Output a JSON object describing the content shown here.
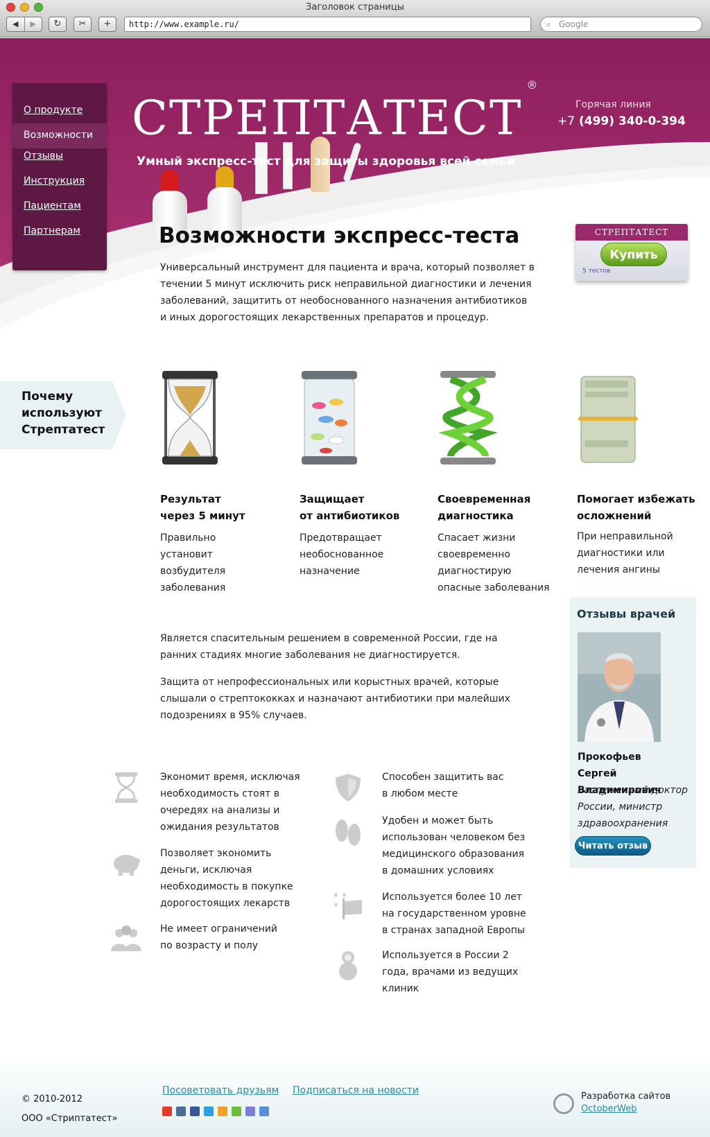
{
  "browser": {
    "title": "Заголовок страницы",
    "url": "http://www.example.ru/",
    "search_placeholder": "Google",
    "back_label": "◀",
    "forward_label": "▶",
    "reload_label": "↻",
    "snip_label": "✂",
    "newtab_label": "+"
  },
  "nav": {
    "items": [
      {
        "label": "О продукте"
      },
      {
        "label": "Возможности"
      },
      {
        "label": "Отзывы"
      },
      {
        "label": "Инструкция"
      },
      {
        "label": "Пациентам"
      },
      {
        "label": "Партнерам"
      }
    ],
    "active_index": 1
  },
  "header": {
    "brand": "СТРЕПТАТЕСТ",
    "brand_mark": "®",
    "tagline": "Умный экспресс-тест для защиты здоровья всей семьи",
    "hotline_label": "Горячая линия",
    "hotline_prefix": "+7",
    "hotline_number": "(499) 340-0-394"
  },
  "intro": {
    "title": "Возможности экспресс-теста",
    "text": "Универсальный инструмент для пациента и врача, который позволяет в течении 5 минут исключить риск неправильной диагностики и лечения заболеваний, защитить от необоснованного назначения антибиотиков и иных дорогостоящих лекарственных препаратов и процедур."
  },
  "buy": {
    "box_brand": "СТРЕПТАТЕСТ",
    "button_label": "Купить",
    "count_label": "5 тестов"
  },
  "why": {
    "heading_line1": "Почему",
    "heading_line2": "используют",
    "heading_line3": "Стрептатест"
  },
  "features": [
    {
      "title_line1": "Результат",
      "title_line2": "через 5 минут",
      "desc": "Правильно установит возбудителя заболевания",
      "icon": "hourglass-icon"
    },
    {
      "title_line1": "Защищает",
      "title_line2": "от антибиотиков",
      "desc": "Предотвращает необоснованное назначение",
      "icon": "pills-jar-icon"
    },
    {
      "title_line1": "Своевременная",
      "title_line2": "диагностика",
      "desc": "Спасает жизни своевременно диагностирую опасные заболевания",
      "icon": "dna-icon"
    },
    {
      "title_line1": "Помогает избежать",
      "title_line2": "осложнений",
      "desc": "При неправильной диагностики или лечения ангины",
      "icon": "money-roll-icon"
    }
  ],
  "paragraphs": [
    "Является спасительным решением в современной России, где на ранних стадиях многие заболевания не диагностируется.",
    "Защита от непрофессиональных или корыстных врачей, которые слышали о стрептококках и назначают антибиотики при малейших подозрениях в 95% случаев."
  ],
  "benefits_left": [
    {
      "icon": "hourglass-icon",
      "text": "Экономит время, исключая необходимость стоят в очередях на анализы и ожидания результатов"
    },
    {
      "icon": "piggy-bank-icon",
      "text": "Позволяет экономить деньги, исключая необходимость в покупке дорогостоящих лекарств"
    },
    {
      "icon": "people-icon",
      "text": "Не имеет ограничений по возрасту и полу"
    }
  ],
  "benefits_right": [
    {
      "icon": "shield-icon",
      "text": "Способен защитить вас в любом месте"
    },
    {
      "icon": "flip-flops-icon",
      "text": "Удобен и может быть использован человеком без медицинского образования в домашних условиях"
    },
    {
      "icon": "eu-flag-icon",
      "text": "Используется более 10 лет на государственном уровне в странах западной Европы"
    },
    {
      "icon": "matryoshka-icon",
      "text": "Используется в России 2 года, врачами из ведущих клиник"
    }
  ],
  "reviews": {
    "title": "Отзывы врачей",
    "name_line1": "Прокофьев",
    "name_line2": "Сергей Владимирович",
    "role": "Заслуженный доктор России, министр здравоохранения",
    "button_label": "Читать отзыв"
  },
  "footer": {
    "copyright": "© 2010-2012",
    "company": "ООО «Стриптатест»",
    "link_recommend": "Посоветовать друзьям",
    "link_subscribe": "Подписаться на новости",
    "dev_label": "Разработка сайтов",
    "dev_link": "OctoberWeb"
  },
  "colors": {
    "brand_purple": "#9a2a6c",
    "nav_dark": "#5e1844",
    "accent_green": "#6fb42c",
    "link_blue": "#2a8aa6"
  }
}
